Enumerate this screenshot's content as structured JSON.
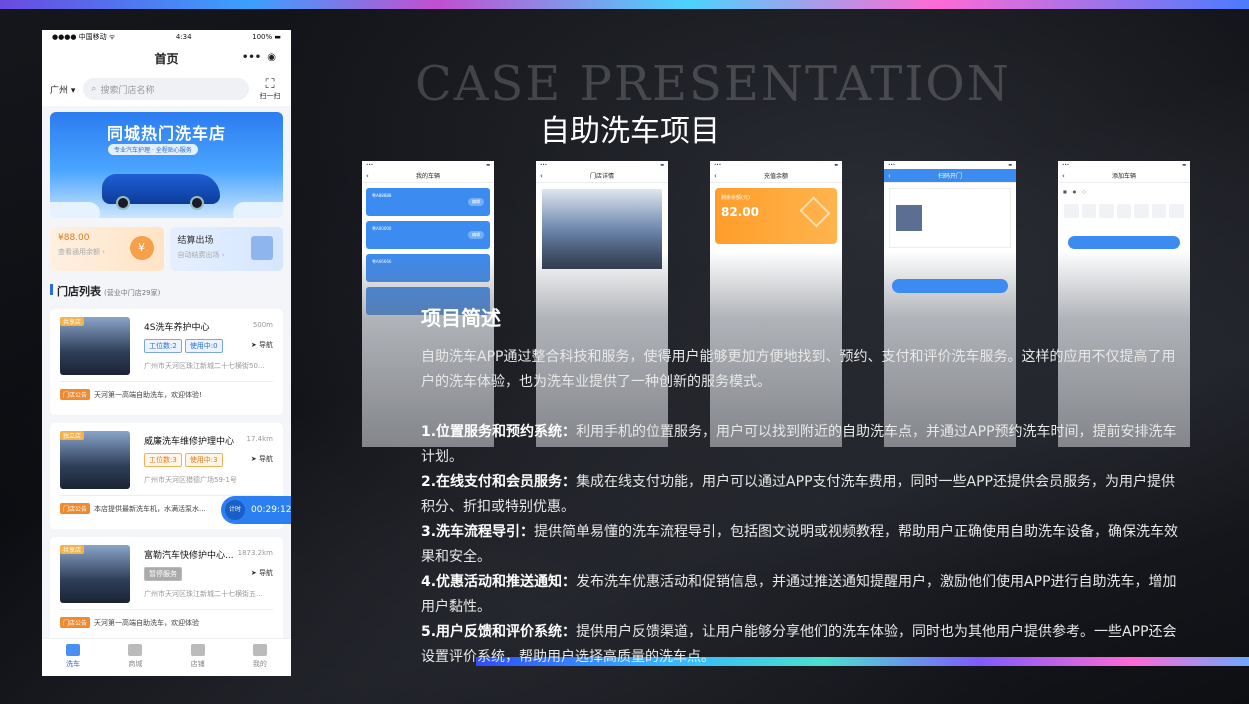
{
  "slide": {
    "case_title": "CASE PRESENTATION",
    "main_title": "自助洗车项目"
  },
  "phone": {
    "status": {
      "carrier": "●●●● 中国移动 ᯤ",
      "time": "4:34",
      "battery": "100% ▬"
    },
    "nav": {
      "title": "首页",
      "more": "•••",
      "target": "◉"
    },
    "search": {
      "city": "广州 ▾",
      "placeholder": "搜索门店名称",
      "scan_label": "扫一扫"
    },
    "banner": {
      "title": "同城热门洗车店",
      "subtitle": "专业汽车护理 · 全程贴心服务"
    },
    "cards": [
      {
        "title": "¥88.00",
        "sub": "查看通用余额 ›"
      },
      {
        "title": "结算出场",
        "sub": "自动结费出场 ›"
      }
    ],
    "list_header": {
      "title": "门店列表",
      "sub": "(营业中门店29家)"
    },
    "stores": [
      {
        "tag": "共享店",
        "name": "4S洗车养护中心",
        "distance": "500m",
        "pill1": "工位数:2",
        "pill2": "使用中:0",
        "nav": "导航",
        "address": "广州市天河区珠江新城二十七横街50...",
        "promo_tag": "门店公告",
        "promo": "天河第一高端自助洗车，欢迎体验!"
      },
      {
        "tag": "独立店",
        "name": "威廉洗车维修护理中心",
        "distance": "17.4km",
        "pill1": "工位数:3",
        "pill2": "使用中:3",
        "nav": "导航",
        "address": "广州市天河区猎德广场59-1号",
        "promo_tag": "门店公告",
        "promo": "本店提供最新洗车机，水满活泵水..."
      },
      {
        "tag": "共享店",
        "name": "富勒汽车快修护中心...",
        "distance": "1873.2km",
        "pill1": "暂停服务",
        "pill2": "",
        "nav": "导航",
        "address": "广州市天河区珠江新城二十七横街五...",
        "promo_tag": "门店公告",
        "promo": "天河第一高端自助洗车，欢迎体验"
      }
    ],
    "timer": {
      "label": "计时",
      "time": "00:29:12"
    },
    "tabs": [
      {
        "label": "洗车",
        "icon": "home-icon"
      },
      {
        "label": "商城",
        "icon": "mail-icon"
      },
      {
        "label": "店铺",
        "icon": "store-icon"
      },
      {
        "label": "我的",
        "icon": "user-icon"
      }
    ]
  },
  "minis": [
    {
      "title": "我的车辆"
    },
    {
      "title": "门店详情"
    },
    {
      "title": "充值余额",
      "balance_label": "剩余余额(元)",
      "balance": "82.00"
    },
    {
      "title": "扫码开门"
    },
    {
      "title": "添加车辆"
    }
  ],
  "description": {
    "heading": "项目简述",
    "intro": "自助洗车APP通过整合科技和服务，使得用户能够更加方便地找到、预约、支付和评价洗车服务。这样的应用不仅提高了用户的洗车体验，也为洗车业提供了一种创新的服务模式。",
    "items": [
      {
        "title": "1.位置服务和预约系统：",
        "text": "利用手机的位置服务，用户可以找到附近的自助洗车点，并通过APP预约洗车时间，提前安排洗车计划。"
      },
      {
        "title": "2.在线支付和会员服务：",
        "text": "集成在线支付功能，用户可以通过APP支付洗车费用，同时一些APP还提供会员服务，为用户提供积分、折扣或特别优惠。"
      },
      {
        "title": "3.洗车流程导引：",
        "text": "提供简单易懂的洗车流程导引，包括图文说明或视频教程，帮助用户正确使用自助洗车设备，确保洗车效果和安全。"
      },
      {
        "title": "4.优惠活动和推送通知：",
        "text": "发布洗车优惠活动和促销信息，并通过推送通知提醒用户，激励他们使用APP进行自助洗车，增加用户黏性。"
      },
      {
        "title": "5.用户反馈和评价系统：",
        "text": "提供用户反馈渠道，让用户能够分享他们的洗车体验，同时也为其他用户提供参考。一些APP还会设置评价系统，帮助用户选择高质量的洗车点。"
      }
    ]
  }
}
